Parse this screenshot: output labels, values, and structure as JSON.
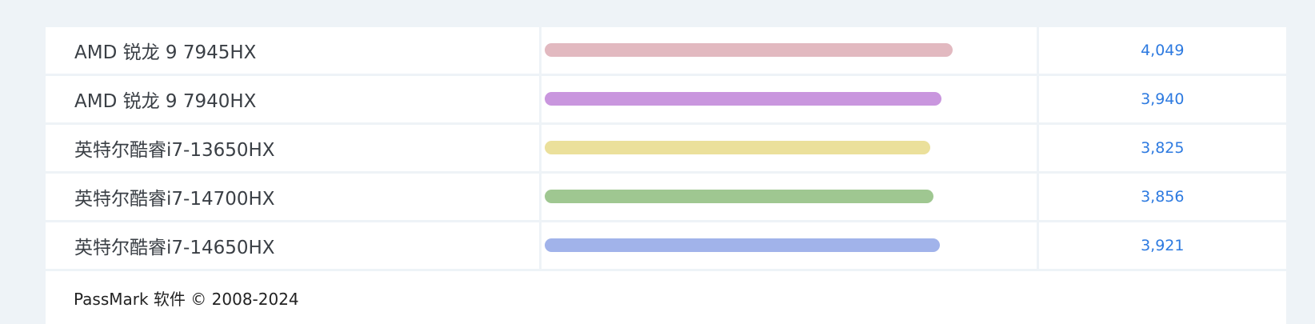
{
  "chart_data": {
    "type": "bar",
    "categories": [
      "AMD 锐龙 9 7945HX",
      "AMD 锐龙 9 7940HX",
      "英特尔酷睿i7-13650HX",
      "英特尔酷睿i7-14700HX",
      "英特尔酷睿i7-14650HX"
    ],
    "values": [
      4049,
      3940,
      3825,
      3856,
      3921
    ],
    "value_labels": [
      "4,049",
      "3,940",
      "3,825",
      "3,856",
      "3,921"
    ],
    "colors": [
      "#e2b9c0",
      "#c996de",
      "#ebe09b",
      "#9fc791",
      "#a1b3ea"
    ],
    "xlim": [
      0,
      4049
    ],
    "title": "",
    "xlabel": "",
    "ylabel": ""
  },
  "footer": {
    "text": "PassMark 软件 © 2008-2024"
  }
}
